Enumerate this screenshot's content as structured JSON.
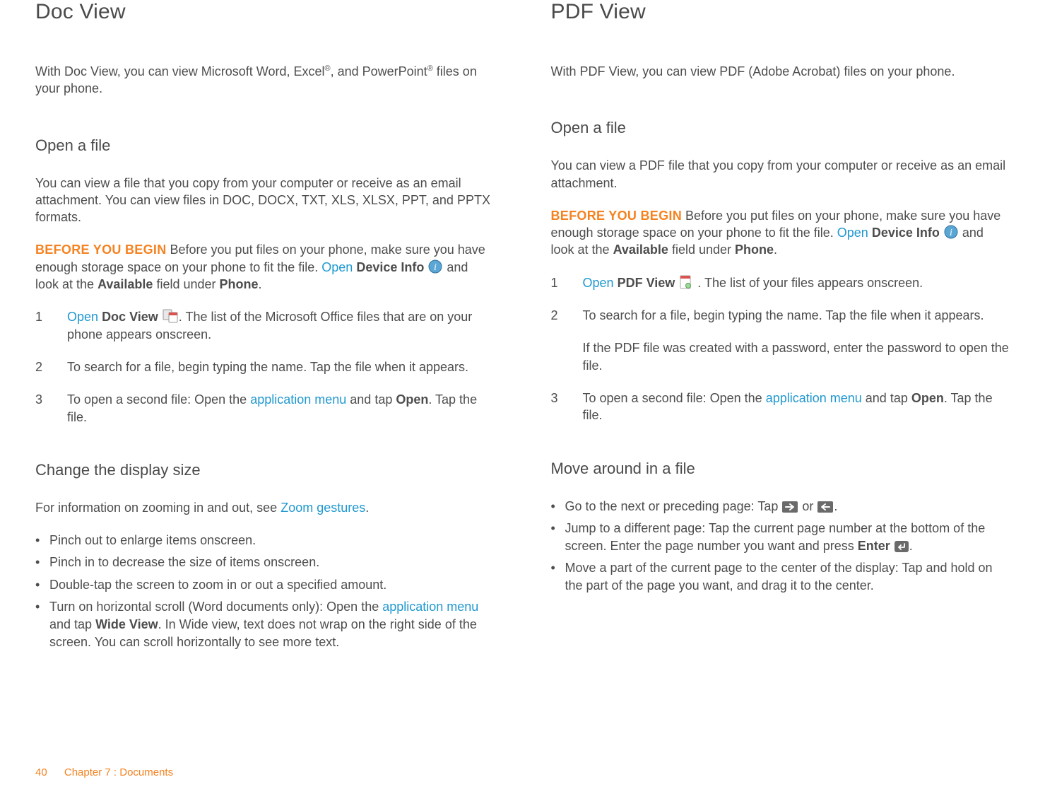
{
  "left": {
    "title": "Doc View",
    "intro_pre": "With Doc View, you can view Microsoft Word, Excel",
    "intro_mid": ", and PowerPoint",
    "intro_post": " files on your phone.",
    "reg": "®",
    "openfile": {
      "heading": "Open a file",
      "p1": "You can view a file that you copy from your computer or receive as an email attachment. You can view files in DOC, DOCX, TXT, XLS, XLSX, PPT, and PPTX formats.",
      "byb_label": "BEFORE YOU BEGIN",
      "byb_a": "  Before you put files on your phone, make sure you have enough storage space on your phone to fit the file. ",
      "byb_open": "Open",
      "byb_b": " ",
      "byb_devinfo": "Device Info",
      "byb_c": " and look at the ",
      "byb_avail": "Available",
      "byb_d": " field under ",
      "byb_phone": "Phone",
      "byb_e": ".",
      "step1_open": "Open",
      "step1_dv": "Doc View",
      "step1_rest": ". The list of the Microsoft Office files that are on your phone appears onscreen.",
      "step2": "To search for a file, begin typing the name. Tap the file when it appears.",
      "step3_a": "To open a second file: Open the ",
      "step3_link": "application menu",
      "step3_b": " and tap ",
      "step3_open": "Open",
      "step3_c": ". Tap the file."
    },
    "display": {
      "heading": "Change the display size",
      "p_a": "For information on zooming in and out, see ",
      "p_link": "Zoom gestures",
      "p_b": ".",
      "b1": "Pinch out to enlarge items onscreen.",
      "b2": "Pinch in to decrease the size of items onscreen.",
      "b3": "Double-tap the screen to zoom in or out a specified amount.",
      "b4_a": "Turn on horizontal scroll (Word documents only): Open the ",
      "b4_link": "application menu",
      "b4_b": " and tap ",
      "b4_wide": "Wide View",
      "b4_c": ". In Wide view, text does not wrap on the right side of the screen. You can scroll horizontally to see more text."
    }
  },
  "right": {
    "title": "PDF View",
    "intro": "With PDF View, you can view PDF (Adobe Acrobat) files on your phone.",
    "openfile": {
      "heading": "Open a file",
      "p1": "You can view a PDF file that you copy from your computer or receive as an email attachment.",
      "byb_label": "BEFORE YOU BEGIN",
      "byb_a": "  Before you put files on your phone, make sure you have enough storage space on your phone to fit the file. ",
      "byb_open": "Open",
      "byb_devinfo": "Device Info",
      "byb_c": " and look at the ",
      "byb_avail": "Available",
      "byb_d": " field under ",
      "byb_phone": "Phone",
      "byb_e": ".",
      "step1_open": "Open",
      "step1_pv": "PDF View",
      "step1_rest": ". The list of your files appears onscreen.",
      "step2": "To search for a file, begin typing the name. Tap the file when it appears.",
      "step2_sub": "If the PDF file was created with a password, enter the password to open the file.",
      "step3_a": "To open a second file: Open the ",
      "step3_link": "application menu",
      "step3_b": " and tap ",
      "step3_open": "Open",
      "step3_c": ". Tap the file."
    },
    "move": {
      "heading": "Move around in a file",
      "b1_a": "Go to the next or preceding page: Tap ",
      "b1_or": " or ",
      "b1_b": ".",
      "b2_a": "Jump to a different page: Tap the current page number at the bottom of the screen. Enter the page number you want and press ",
      "b2_enter": "Enter",
      "b2_b": ".",
      "b3": "Move a part of the current page to the center of the display: Tap and hold on the part of the page you want, and drag it to the center."
    }
  },
  "footer": {
    "page": "40",
    "chapter": "Chapter 7 : Documents"
  }
}
